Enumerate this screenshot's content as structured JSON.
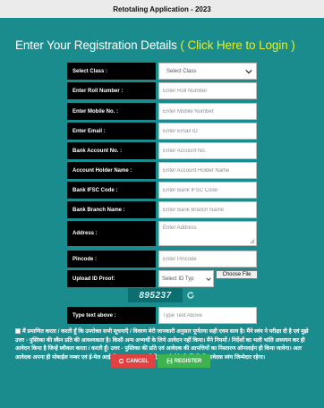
{
  "window": {
    "title": "Retotaling Application - 2023"
  },
  "heading": {
    "text": "Enter Your Registration Details",
    "open_paren": "(",
    "login_link": "Click Here to Login",
    "close_paren": ")"
  },
  "form": {
    "select_class": {
      "label": "Select Class :",
      "value": "Select Class"
    },
    "roll_number": {
      "label": "Enter Roll Number :",
      "placeholder": "Enter Roll Number"
    },
    "mobile": {
      "label": "Enter Mobile No. :",
      "placeholder": "Enter Mobile Number"
    },
    "email": {
      "label": "Enter Email :",
      "placeholder": "Enter Email ID"
    },
    "bank_account": {
      "label": "Bank Account No. :",
      "placeholder": "Enter Account No."
    },
    "account_holder": {
      "label": "Account Holder Name :",
      "placeholder": "Enter Account Holder Name"
    },
    "ifsc": {
      "label": "Bank IFSC Code :",
      "placeholder": "Enter Bank IFSC Code"
    },
    "branch": {
      "label": "Bank Branch Name :",
      "placeholder": "Enter Bank Branch Name"
    },
    "address": {
      "label": "Address :",
      "placeholder": "Enter Address"
    },
    "pincode": {
      "label": "Pincode :",
      "placeholder": "Enter Pincode"
    },
    "upload_id": {
      "label": "Upload ID Proof:",
      "select_value": "Select ID Typ",
      "file_button": "Choose File"
    },
    "captcha": {
      "value": "895237"
    },
    "type_text": {
      "label": "Type text above :",
      "placeholder": "Type Text Above"
    }
  },
  "declaration": "मैं प्रमाणित करता / करती हूँ कि उपरोक्त सभी सूचनाएँ / विवरण मेरी जानकारी अनुसार पूर्णतया सही एवम सत्य है। मैंने स्वंय ने परीक्षा दी है एवं मुझे उत्तर - पुस्तिका की स्कैन प्रति की आवश्यकता है। किसी अन्य अभ्यर्थी के लिये आवेदन नहीं किया। मैंने नियमों / निर्देशों का भली भांति अध्ययन कर ही आवेदन किया है जिन्हें स्वीकार करता / करती हूँ। उत्तर - पुस्तिका की प्रति एवं आवेदक की आपत्तियों का निस्तारण ऑनलाईन ही किया जावेगा। अतः आवेदक अपना ही मोबाईल नम्बर एवं ई-मेल आई.डी. आवश्यक रूप से दें, अपूर्ण होने की स्थिति में आवेदक स्वंय जिम्मेदार रहेगा।",
  "buttons": {
    "cancel": "CANCEL",
    "register": "REGISTER"
  },
  "colors": {
    "background": "#1a8c8e",
    "link": "#e8f01e",
    "label_bg": "#000000",
    "cancel": "#e04242",
    "register": "#3fb34f"
  }
}
